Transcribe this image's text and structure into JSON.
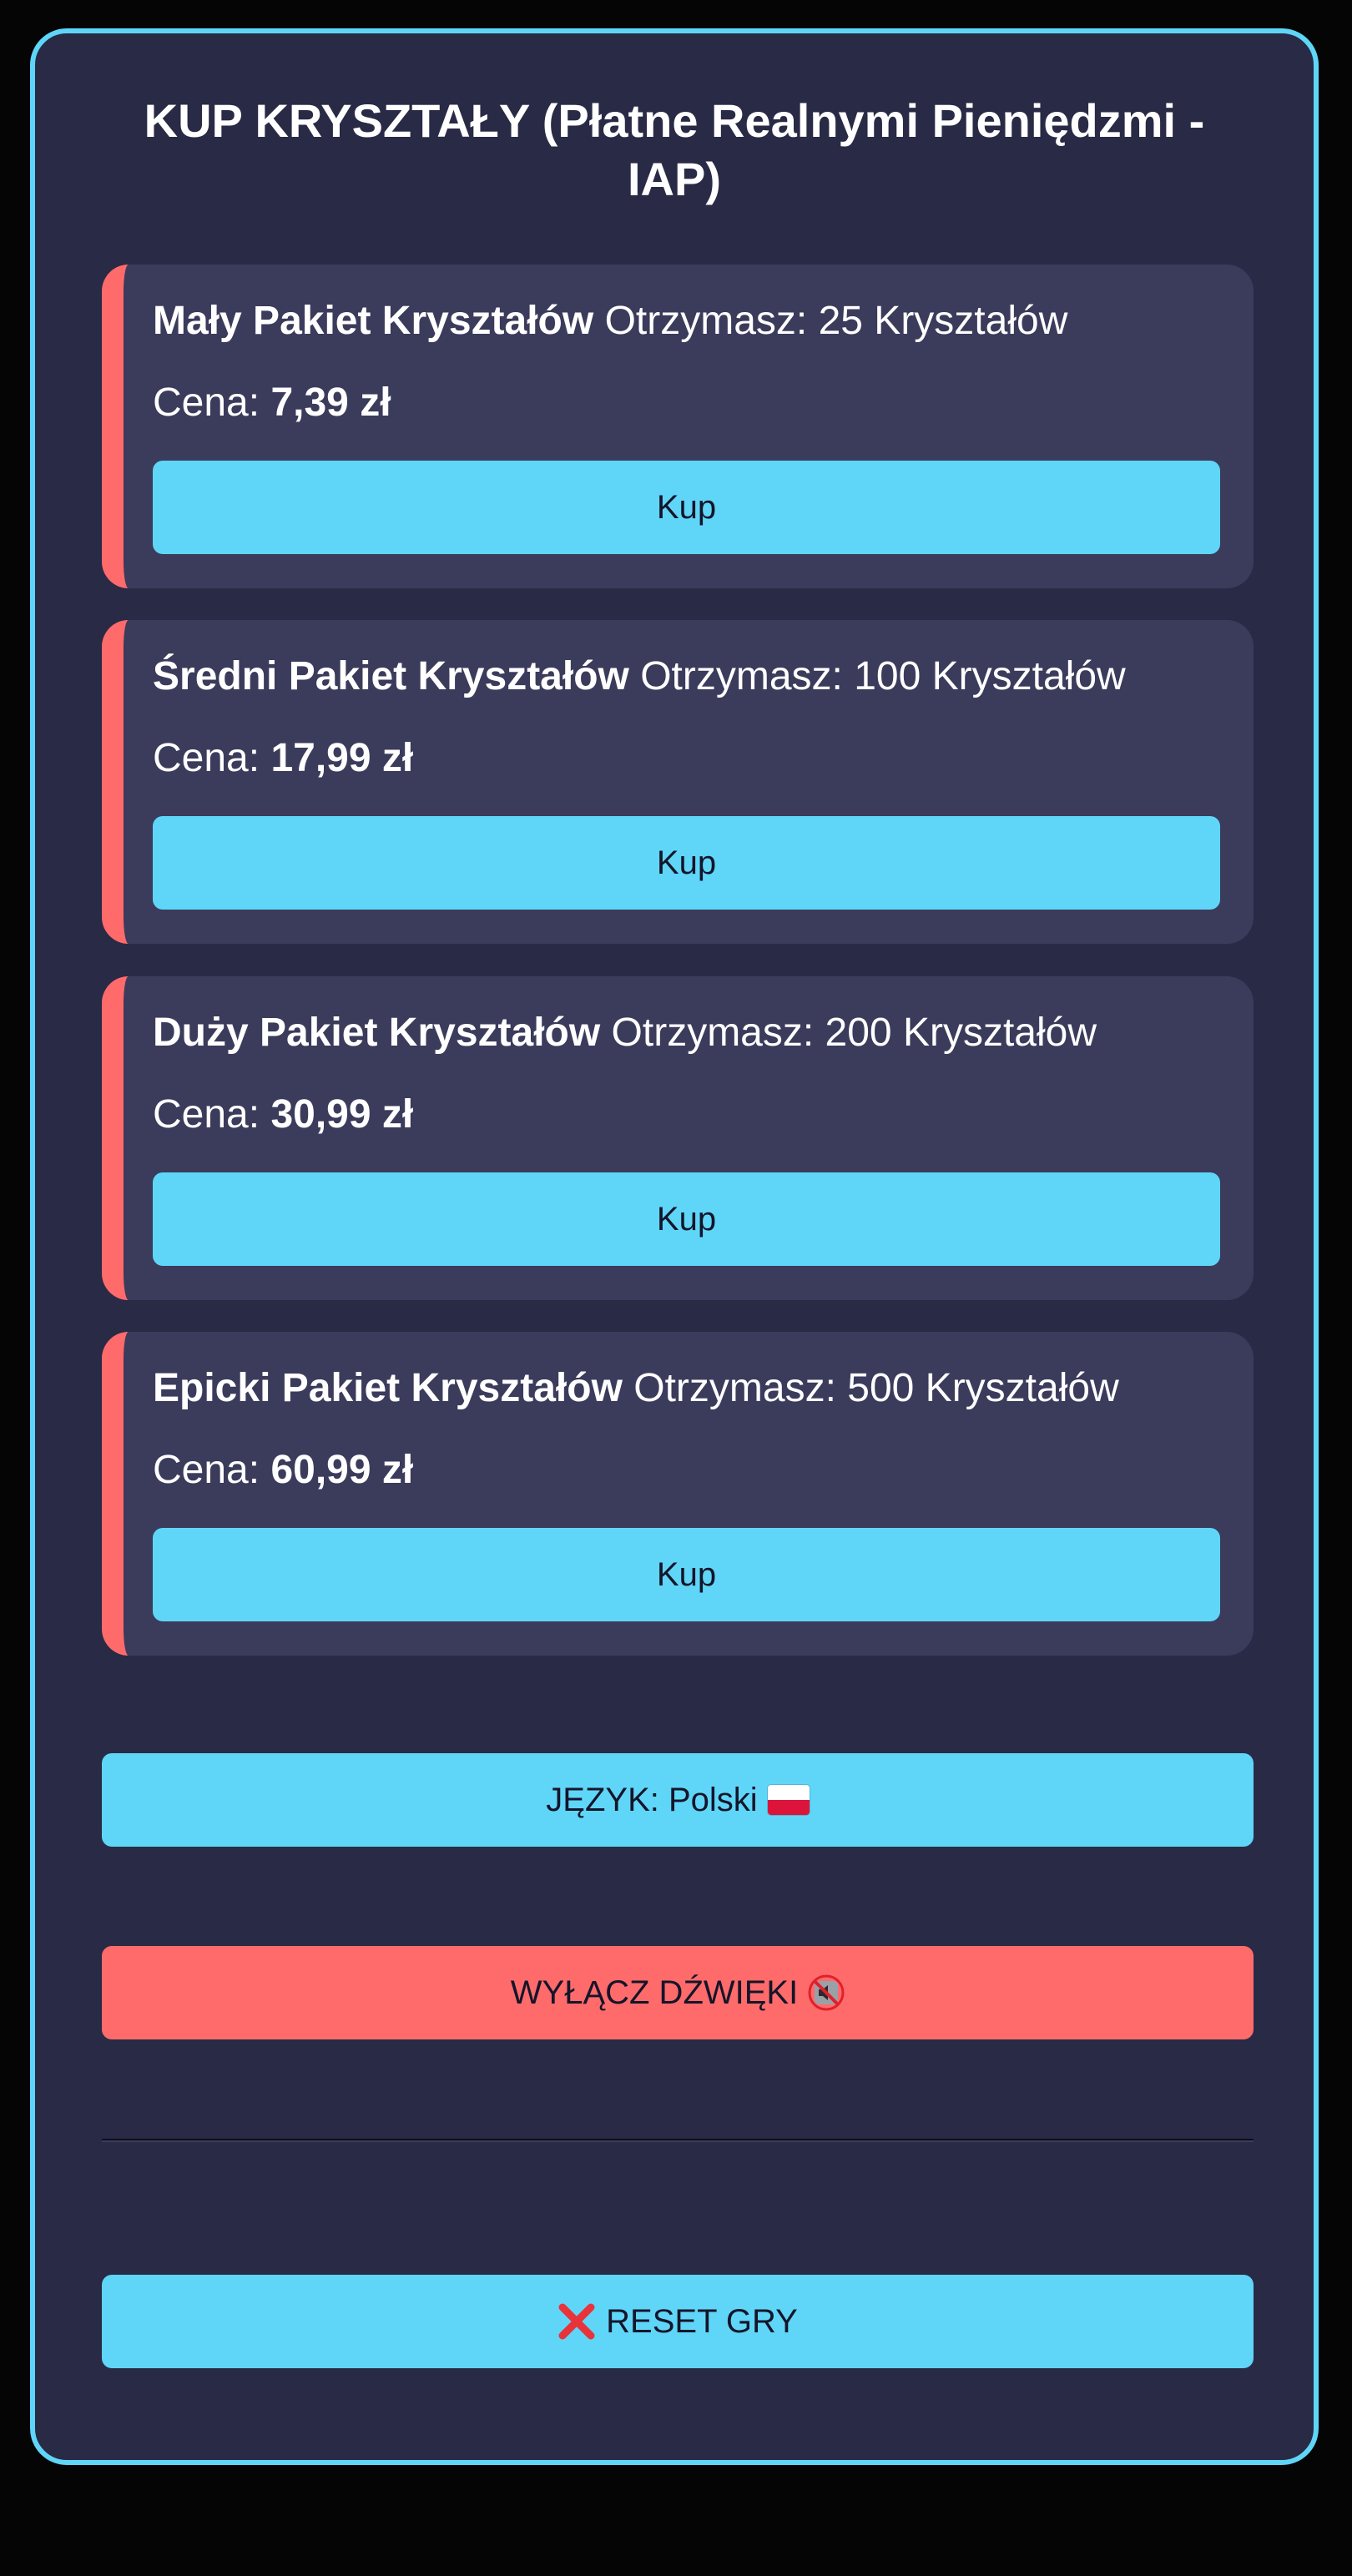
{
  "shop": {
    "title": "KUP KRYSZTAŁY (Płatne Realnymi Pieniędzmi - IAP)",
    "packs": [
      {
        "name": "Mały Pakiet Kryształów",
        "receive": "Otrzymasz: 25 Kryształów",
        "price_label": "Cena:",
        "price": "7,39 zł",
        "button": "Kup"
      },
      {
        "name": "Średni Pakiet Kryształów",
        "receive": "Otrzymasz: 100 Kryształów",
        "price_label": "Cena:",
        "price": "17,99 zł",
        "button": "Kup"
      },
      {
        "name": "Duży Pakiet Kryształów",
        "receive": "Otrzymasz: 200 Kryształów",
        "price_label": "Cena:",
        "price": "30,99 zł",
        "button": "Kup"
      },
      {
        "name": "Epicki Pakiet Kryształów",
        "receive": "Otrzymasz: 500 Kryształów",
        "price_label": "Cena:",
        "price": "60,99 zł",
        "button": "Kup"
      }
    ]
  },
  "settings": {
    "language_label": "JĘZYK: Polski",
    "language_icon": "poland-flag-icon",
    "sound_label": "WYŁĄCZ DŹWIĘKI",
    "sound_icon": "muted-speaker-icon",
    "reset_label": "RESET GRY",
    "reset_icon": "red-x-icon"
  },
  "colors": {
    "accent": "#5fd6f8",
    "danger": "#ff6b6b",
    "panel": "#292a45",
    "card": "#3b3b5c"
  }
}
